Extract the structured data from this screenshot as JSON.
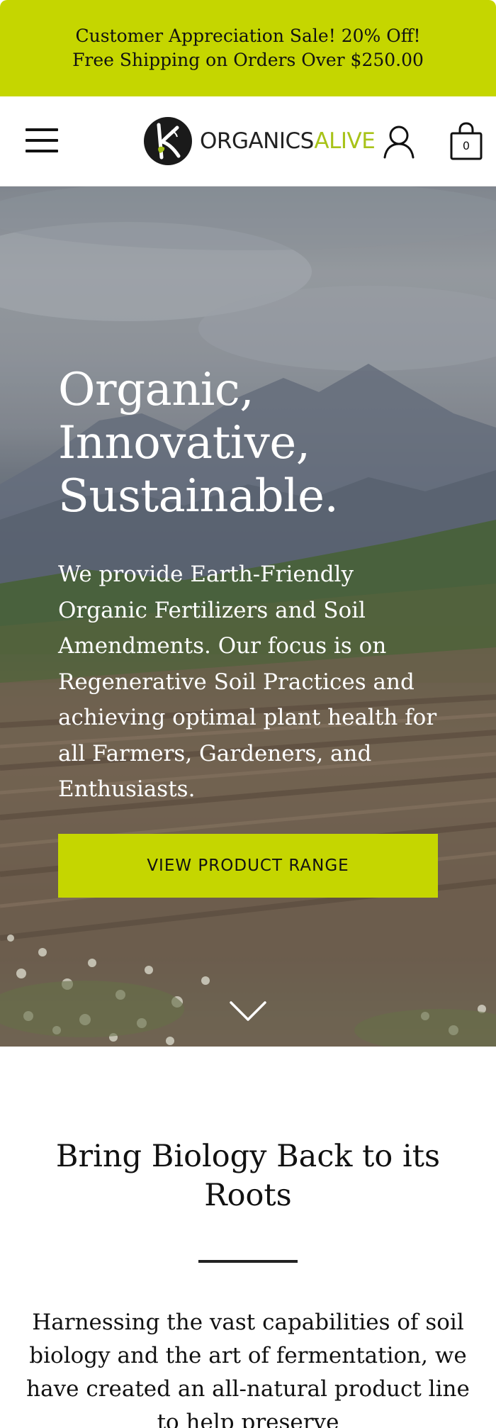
{
  "announcement": {
    "line1": "Customer Appreciation Sale! 20% Off!",
    "line2": "Free Shipping on Orders Over $250.00",
    "background": "#c5d600"
  },
  "header": {
    "menu_icon": "hamburger-menu-icon",
    "logo": {
      "text_part1": "ORGANICS",
      "text_part2": "ALIVE",
      "accent_color": "#a8c319"
    },
    "account_icon": "user-icon",
    "cart_icon": "shopping-bag-icon",
    "cart_count": "0"
  },
  "hero": {
    "title_lines": [
      "Organic,",
      "Innovative,",
      "Sustainable."
    ],
    "description": "We provide Earth-Friendly Organic Fertilizers and Soil Amendments. Our focus is on Regenerative Soil Practices and achieving optimal plant health for all Farmers, Gardeners, and Enthusiasts.",
    "button_label": "VIEW PRODUCT RANGE",
    "button_color": "#c5d600",
    "scroll_icon": "chevron-down-icon"
  },
  "intro": {
    "title_line1": "Bring Biology Back to its",
    "title_line2": "Roots",
    "text": "Harnessing the vast capabilities of soil biology and the art of fermentation, we have created an all-natural product line to help preserve"
  }
}
